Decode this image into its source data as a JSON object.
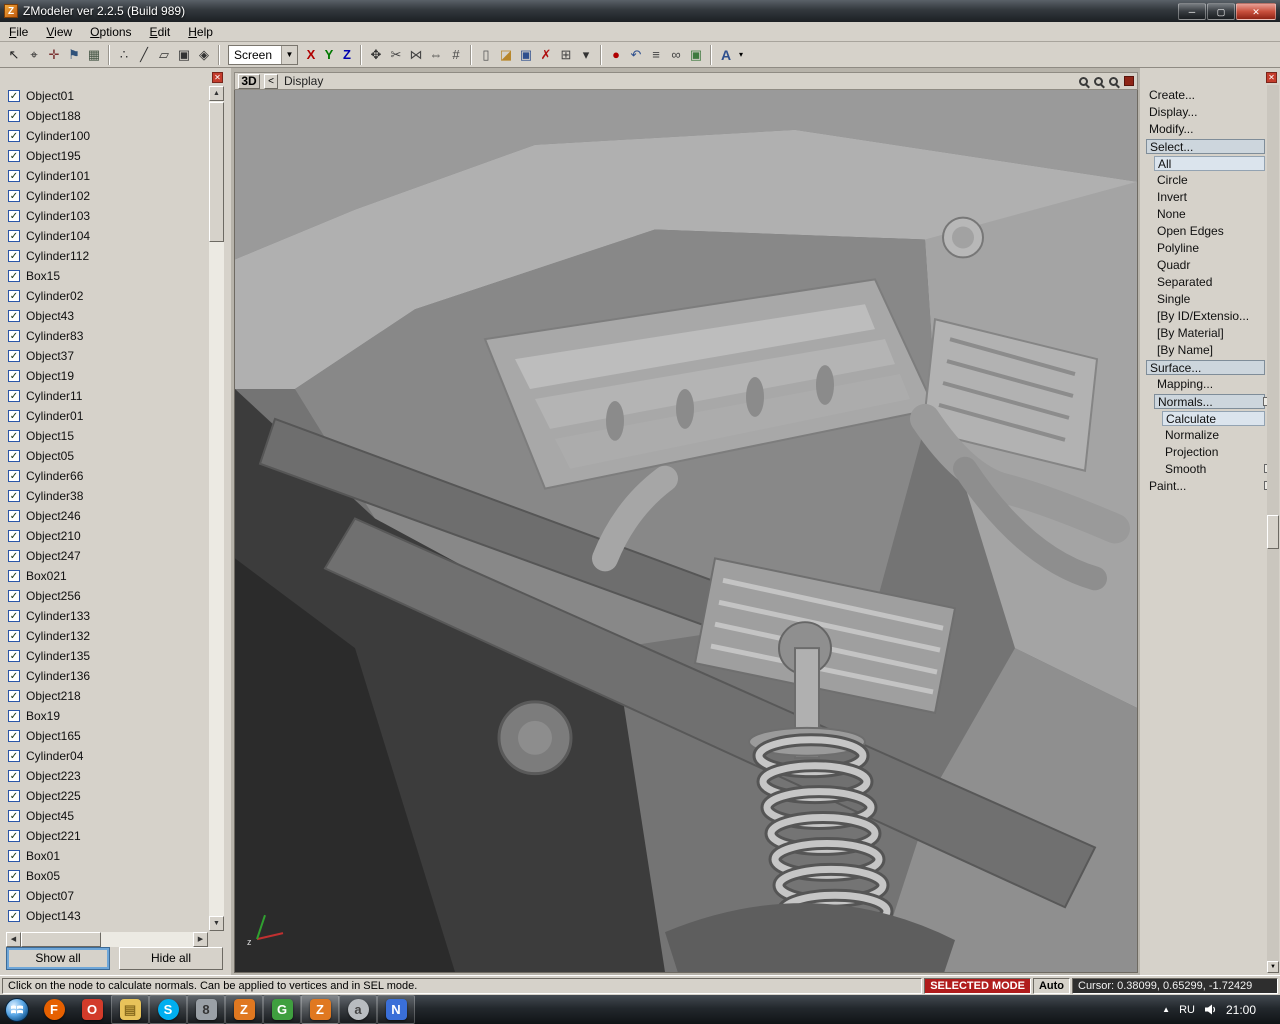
{
  "window": {
    "title": "ZModeler ver 2.2.5 (Build 989)",
    "buttons": [
      {
        "name": "minimize-button",
        "glyph": "─"
      },
      {
        "name": "maximize-button",
        "glyph": "▢"
      },
      {
        "name": "close-button",
        "glyph": "✕"
      }
    ]
  },
  "menus": [
    "File",
    "View",
    "Options",
    "Edit",
    "Help"
  ],
  "icons": {
    "close_glyph": "✕",
    "scroll_up": "▲",
    "scroll_down": "▼",
    "scroll_left": "◀",
    "scroll_right": "▶",
    "check": "✓"
  },
  "toolbar": {
    "screen_label": "Screen",
    "dropdown_glyph": "▼",
    "axis": [
      {
        "label": "X",
        "color": "#b00000"
      },
      {
        "label": "Y",
        "color": "#007800"
      },
      {
        "label": "Z",
        "color": "#0000b0"
      }
    ],
    "groups": {
      "g1": [
        {
          "name": "select-icon",
          "glyph": "↖",
          "color": "#222222"
        },
        {
          "name": "target-icon",
          "glyph": "⌖",
          "color": "#222222"
        },
        {
          "name": "axes-icon",
          "glyph": "✛",
          "color": "#7a3030"
        },
        {
          "name": "flag-icon",
          "glyph": "⚑",
          "color": "#30527a"
        },
        {
          "name": "grid-icon",
          "glyph": "▦",
          "color": "#445544"
        }
      ],
      "g2": [
        {
          "name": "vertices-mode-icon",
          "glyph": "∴",
          "color": "#333333"
        },
        {
          "name": "edges-mode-icon",
          "glyph": "╱",
          "color": "#333333"
        },
        {
          "name": "faces-mode-icon",
          "glyph": "▱",
          "color": "#333333"
        },
        {
          "name": "objects-mode-icon",
          "glyph": "▣",
          "color": "#333333"
        },
        {
          "name": "uv-mode-icon",
          "glyph": "◈",
          "color": "#333333"
        }
      ],
      "g3": [
        {
          "name": "manipulator-icon",
          "glyph": "✥",
          "color": "#333333"
        },
        {
          "name": "weld-icon",
          "glyph": "✂",
          "color": "#444444"
        },
        {
          "name": "unweld-icon",
          "glyph": "⋈",
          "color": "#444444"
        },
        {
          "name": "mirror-icon",
          "glyph": "⇔",
          "color": "#444444"
        },
        {
          "name": "snap-icon",
          "glyph": "#",
          "color": "#444444"
        }
      ],
      "g4": [
        {
          "name": "new-file-icon",
          "glyph": "▯",
          "color": "#555555"
        },
        {
          "name": "open-folder-icon",
          "glyph": "◪",
          "color": "#b8862a"
        },
        {
          "name": "save-icon",
          "glyph": "▣",
          "color": "#2e4f8e"
        },
        {
          "name": "delete-icon",
          "glyph": "✗",
          "color": "#b01010"
        },
        {
          "name": "copy-icon",
          "glyph": "⊞",
          "color": "#444444"
        },
        {
          "name": "paste-dropdown-icon",
          "glyph": "▾",
          "color": "#333333"
        }
      ],
      "g5": [
        {
          "name": "record-icon",
          "glyph": "●",
          "color": "#b00000"
        },
        {
          "name": "undo-icon",
          "glyph": "↶",
          "color": "#2e4f8e"
        },
        {
          "name": "notes-icon",
          "glyph": "≡",
          "color": "#444444"
        },
        {
          "name": "link-icon",
          "glyph": "∞",
          "color": "#444444"
        },
        {
          "name": "image-icon",
          "glyph": "▣",
          "color": "#3f7a3f"
        }
      ]
    },
    "font_tool": {
      "label": "A",
      "color": "#2e4f8e",
      "dropdown_glyph": "▾"
    }
  },
  "sidebar": {
    "items": [
      "Object01",
      "Object188",
      "Cylinder100",
      "Object195",
      "Cylinder101",
      "Cylinder102",
      "Cylinder103",
      "Cylinder104",
      "Cylinder112",
      "Box15",
      "Cylinder02",
      "Object43",
      "Cylinder83",
      "Object37",
      "Object19",
      "Cylinder11",
      "Cylinder01",
      "Object15",
      "Object05",
      "Cylinder66",
      "Cylinder38",
      "Object246",
      "Object210",
      "Object247",
      "Box021",
      "Object256",
      "Cylinder133",
      "Cylinder132",
      "Cylinder135",
      "Cylinder136",
      "Object218",
      "Box19",
      "Object165",
      "Cylinder04",
      "Object223",
      "Object225",
      "Object45",
      "Object221",
      "Box01",
      "Box05",
      "Object07",
      "Object143"
    ],
    "show_all": "Show all",
    "hide_all": "Hide all"
  },
  "viewport": {
    "label": "3D",
    "back": "<",
    "breadcrumb": "Display",
    "icons": [
      {
        "name": "zoom-in-icon"
      },
      {
        "name": "zoom-out-icon"
      },
      {
        "name": "zoom-window-icon"
      }
    ]
  },
  "right_panel": {
    "items": [
      {
        "label": "Create...",
        "indent": 0,
        "style": ""
      },
      {
        "label": "Display...",
        "indent": 0,
        "style": ""
      },
      {
        "label": "Modify...",
        "indent": 0,
        "style": ""
      },
      {
        "label": "Select...",
        "indent": 0,
        "style": "boxed"
      },
      {
        "label": "All",
        "indent": 1,
        "style": "highlight"
      },
      {
        "label": "Circle",
        "indent": 1,
        "style": ""
      },
      {
        "label": "Invert",
        "indent": 1,
        "style": ""
      },
      {
        "label": "None",
        "indent": 1,
        "style": ""
      },
      {
        "label": "Open Edges",
        "indent": 1,
        "style": ""
      },
      {
        "label": "Polyline",
        "indent": 1,
        "style": ""
      },
      {
        "label": "Quadr",
        "indent": 1,
        "style": ""
      },
      {
        "label": "Separated",
        "indent": 1,
        "style": ""
      },
      {
        "label": "Single",
        "indent": 1,
        "style": ""
      },
      {
        "label": "[By ID/Extensio...",
        "indent": 1,
        "style": ""
      },
      {
        "label": "[By Material]",
        "indent": 1,
        "style": ""
      },
      {
        "label": "[By Name]",
        "indent": 1,
        "style": ""
      },
      {
        "label": "Surface...",
        "indent": 0,
        "style": "boxed"
      },
      {
        "label": "Mapping...",
        "indent": 1,
        "style": ""
      },
      {
        "label": "Normals...",
        "indent": 1,
        "style": "boxed",
        "box": true
      },
      {
        "label": "Calculate",
        "indent": 2,
        "style": "highlight"
      },
      {
        "label": "Normalize",
        "indent": 2,
        "style": ""
      },
      {
        "label": "Projection",
        "indent": 2,
        "style": ""
      },
      {
        "label": "Smooth",
        "indent": 2,
        "style": "",
        "box": true
      },
      {
        "label": "Paint...",
        "indent": 0,
        "style": "",
        "box": true
      }
    ]
  },
  "status_bar": {
    "message": "Click on the node to calculate normals. Can be applied to vertices and in SEL mode.",
    "mode": "SELECTED MODE",
    "auto": "Auto",
    "cursor": "Cursor: 0.38099, 0.65299, -1.72429"
  },
  "taskbar": {
    "icons": [
      {
        "name": "firefox-icon",
        "glyph": "F",
        "bg": "#e66000",
        "fg": "#ffffff",
        "shape": "circle"
      },
      {
        "name": "browser-icon",
        "glyph": "O",
        "bg": "#d23b2a",
        "fg": "#ffffff"
      },
      {
        "name": "explorer-icon",
        "glyph": "▤",
        "bg": "#e8c35a",
        "fg": "#8a6d1f",
        "open": true
      },
      {
        "name": "skype-icon",
        "glyph": "S",
        "bg": "#00aff0",
        "fg": "#ffffff",
        "open": true,
        "shape": "circle"
      },
      {
        "name": "archive-icon",
        "glyph": "8",
        "bg": "#9aa0a6",
        "fg": "#333333",
        "open": true
      },
      {
        "name": "zmodeler-icon",
        "glyph": "Z",
        "bg": "#e07820",
        "fg": "#ffffff",
        "open": true
      },
      {
        "name": "gmax-icon",
        "glyph": "G",
        "bg": "#3f9f3f",
        "fg": "#ffffff",
        "open": true
      },
      {
        "name": "zmodeler-active-icon",
        "glyph": "Z",
        "bg": "#e07820",
        "fg": "#ffffff",
        "open": true,
        "active": true
      },
      {
        "name": "daemon-icon",
        "glyph": "a",
        "bg": "#b8bcc0",
        "fg": "#444444",
        "open": true,
        "shape": "circle"
      },
      {
        "name": "editor-icon",
        "glyph": "N",
        "bg": "#3a6fd8",
        "fg": "#ffffff",
        "open": true
      }
    ],
    "tray": {
      "expand": "▲",
      "lang": "RU",
      "time": "21:00"
    }
  }
}
